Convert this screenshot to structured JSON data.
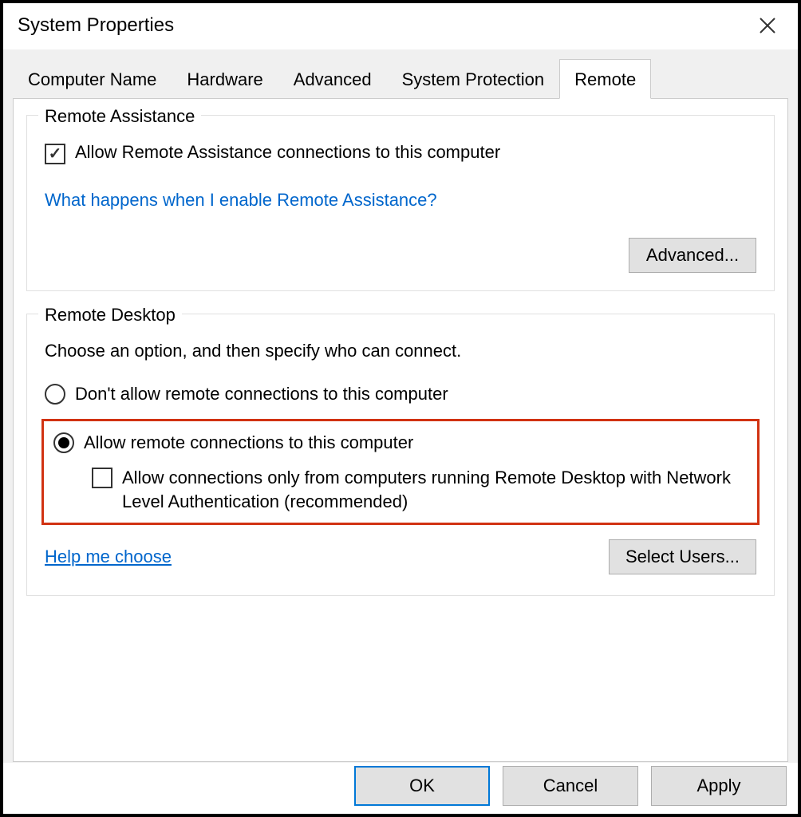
{
  "window": {
    "title": "System Properties"
  },
  "tabs": [
    {
      "label": "Computer Name"
    },
    {
      "label": "Hardware"
    },
    {
      "label": "Advanced"
    },
    {
      "label": "System Protection"
    },
    {
      "label": "Remote"
    }
  ],
  "remote_assistance": {
    "group_label": "Remote Assistance",
    "allow_label": "Allow Remote Assistance connections to this computer",
    "allow_checked": true,
    "help_link": "What happens when I enable Remote Assistance?",
    "advanced_btn": "Advanced..."
  },
  "remote_desktop": {
    "group_label": "Remote Desktop",
    "description": "Choose an option, and then specify who can connect.",
    "radio_dont_allow": "Don't allow remote connections to this computer",
    "radio_allow": "Allow remote connections to this computer",
    "selected": "allow",
    "nla_label": "Allow connections only from computers running Remote Desktop with Network Level Authentication (recommended)",
    "nla_checked": false,
    "help_link": "Help me choose",
    "select_users_btn": "Select Users..."
  },
  "footer": {
    "ok": "OK",
    "cancel": "Cancel",
    "apply": "Apply"
  }
}
